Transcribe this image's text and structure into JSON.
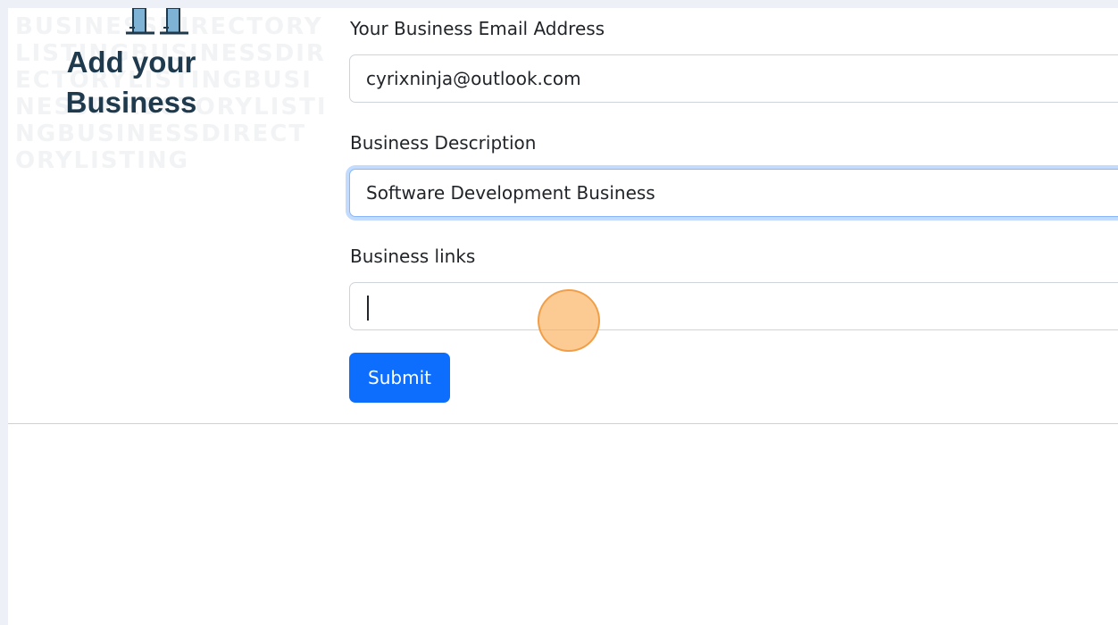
{
  "logo": {
    "line1": "Add your",
    "line2": "Business",
    "background_text": "BUSINESSDIRECTORYLISTINGBUSINESSDIRECTORYLISTINGBUSINESSDIRECTORYLISTINGBUSINESSDIRECTORYLISTING",
    "icon": "building-icon"
  },
  "form": {
    "email_label": "Your Business Email Address",
    "email_value": "cyrixninja@outlook.com",
    "description_label": "Business Description",
    "description_value": "Software Development Business",
    "links_label": "Business links",
    "links_value": "",
    "submit_label": "Submit"
  },
  "colors": {
    "page_background": "#eef0f8",
    "logo_text": "#1f3a4d",
    "primary_button": "#0d6efd",
    "focus_ring": "#86b7fe",
    "click_indicator": "#faaf5a"
  }
}
